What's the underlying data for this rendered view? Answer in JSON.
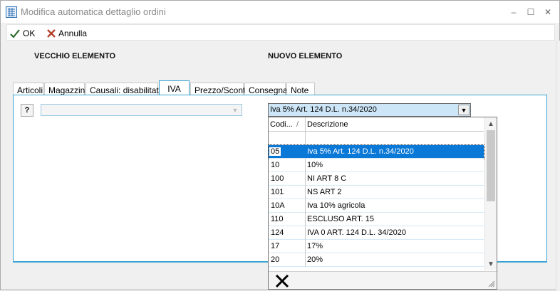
{
  "window": {
    "title": "Modifica automatica dettaglio ordini",
    "controls": [
      "–",
      "☐",
      "✕"
    ]
  },
  "toolbar": {
    "ok_label": "OK",
    "cancel_label": "Annulla"
  },
  "sections": {
    "old_label": "VECCHIO ELEMENTO",
    "new_label": "NUOVO ELEMENTO"
  },
  "tabs": [
    {
      "label": "Articoli"
    },
    {
      "label": "Magazzini"
    },
    {
      "label": "Causali: disabilitato"
    },
    {
      "label": "IVA"
    },
    {
      "label": "Prezzo/Sconti"
    },
    {
      "label": "Consegna"
    },
    {
      "label": "Note"
    }
  ],
  "active_tab": "IVA",
  "help_button": "?",
  "old_combo": {
    "value": ""
  },
  "new_combo": {
    "value": "Iva 5% Art. 124 D.L. n.34/2020"
  },
  "dropdown": {
    "columns": [
      "Codi...",
      "Descrizione"
    ],
    "sort_indicator": "/",
    "rows": [
      {
        "code": "",
        "desc": ""
      },
      {
        "code": "05",
        "desc": "Iva 5% Art. 124 D.L. n.34/2020"
      },
      {
        "code": "10",
        "desc": "10%"
      },
      {
        "code": "100",
        "desc": "NI ART 8 C"
      },
      {
        "code": "101",
        "desc": "NS ART 2"
      },
      {
        "code": "10A",
        "desc": "Iva 10% agricola"
      },
      {
        "code": "110",
        "desc": "ESCLUSO ART. 15"
      },
      {
        "code": "124",
        "desc": "IVA 0 ART. 124 D.L. 34/2020"
      },
      {
        "code": "17",
        "desc": "17%"
      },
      {
        "code": "20",
        "desc": "20%"
      }
    ],
    "selected_index": 1
  },
  "colors": {
    "accent": "#3aa3d1",
    "selection": "#0a78d7",
    "ok_check": "#2d6a2d",
    "cancel_x": "#b5442e"
  }
}
